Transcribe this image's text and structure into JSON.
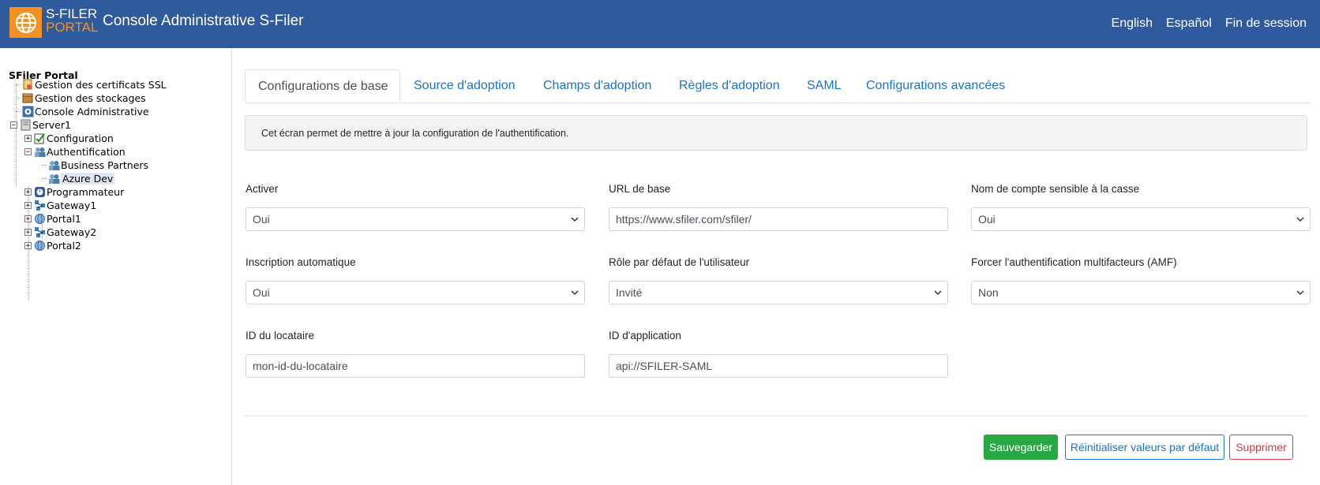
{
  "header": {
    "logo_line1": "S-FILER",
    "logo_line2": "PORTAL",
    "title": "Console Administrative S-Filer",
    "links": [
      "English",
      "Español",
      "Fin de session"
    ]
  },
  "sidebar": {
    "root": "SFiler Portal",
    "items": [
      {
        "label": "Gestion des certificats SSL",
        "icon": "certificate-icon"
      },
      {
        "label": "Gestion des stockages",
        "icon": "storage-box-icon"
      },
      {
        "label": "Console Administrative",
        "icon": "gear-icon"
      },
      {
        "label": "Server1",
        "icon": "server-icon",
        "expander": "−"
      },
      {
        "label": "Configuration",
        "icon": "checklist-icon",
        "expander": "+"
      },
      {
        "label": "Authentification",
        "icon": "users-icon",
        "expander": "−"
      },
      {
        "label": "Business Partners",
        "icon": "users-icon"
      },
      {
        "label": "Azure Dev",
        "icon": "users-icon",
        "selected": true
      },
      {
        "label": "Programmateur",
        "icon": "clock-icon",
        "expander": "+"
      },
      {
        "label": "Gateway1",
        "icon": "network-icon",
        "expander": "+"
      },
      {
        "label": "Portal1",
        "icon": "globe-icon",
        "expander": "+"
      },
      {
        "label": "Gateway2",
        "icon": "network-icon",
        "expander": "+"
      },
      {
        "label": "Portal2",
        "icon": "globe-icon",
        "expander": "+"
      }
    ]
  },
  "tabs": [
    {
      "label": "Configurations de base",
      "active": true
    },
    {
      "label": "Source d'adoption"
    },
    {
      "label": "Champs d'adoption"
    },
    {
      "label": "Règles d'adoption"
    },
    {
      "label": "SAML"
    },
    {
      "label": "Configurations avancées"
    }
  ],
  "info_text": "Cet écran permet de mettre à jour la configuration de l'authentification.",
  "form": {
    "activer": {
      "label": "Activer",
      "value": "Oui"
    },
    "url_base": {
      "label": "URL de base",
      "value": "https://www.sfiler.com/sfiler/"
    },
    "case_sensitive": {
      "label": "Nom de compte sensible à la casse",
      "value": "Oui"
    },
    "auto_inscription": {
      "label": "Inscription automatique",
      "value": "Oui"
    },
    "default_role": {
      "label": "Rôle par défaut de l'utilisateur",
      "value": "Invité"
    },
    "mfa": {
      "label": "Forcer l'authentification multifacteurs (AMF)",
      "value": "Non"
    },
    "tenant_id": {
      "label": "ID du locataire",
      "value": "mon-id-du-locataire"
    },
    "app_id": {
      "label": "ID d'application",
      "value": "api://SFILER-SAML"
    }
  },
  "buttons": {
    "save": "Sauvegarder",
    "reset": "Réinitialiser valeurs par défaut",
    "delete": "Supprimer"
  },
  "colors": {
    "header_bg": "#2f5a9e",
    "logo_orange": "#f39222",
    "link_blue": "#1a73c7",
    "save_green": "#28a745",
    "delete_red": "#dc3545"
  }
}
